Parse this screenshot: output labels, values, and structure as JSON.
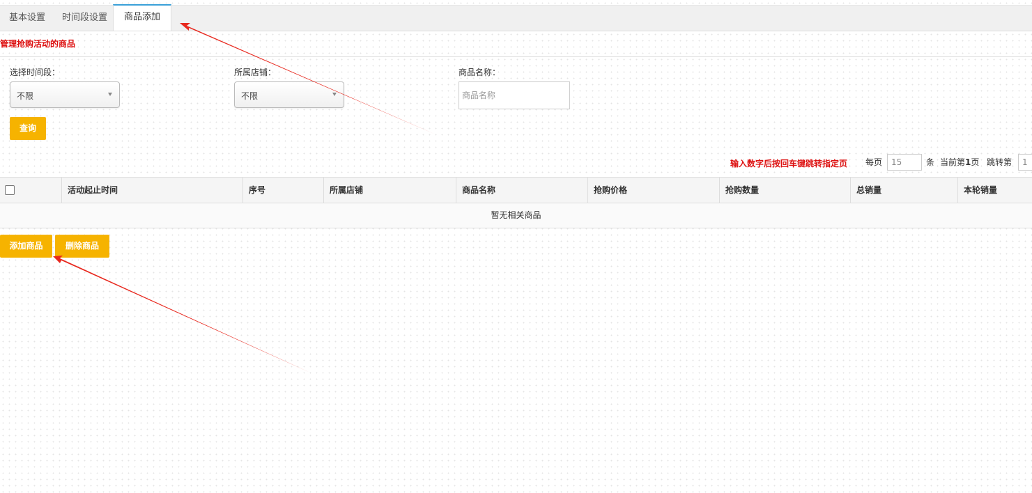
{
  "tabs": [
    {
      "label": "基本设置",
      "active": false
    },
    {
      "label": "时间段设置",
      "active": false
    },
    {
      "label": "商品添加",
      "active": true
    }
  ],
  "section_title": "管理抢购活动的商品",
  "filters": {
    "time_label": "选择时间段：",
    "time_value": "不限",
    "shop_label": "所属店铺：",
    "shop_value": "不限",
    "name_label": "商品名称：",
    "name_placeholder": "商品名称"
  },
  "query_button": "查询",
  "pager": {
    "hint": "输入数字后按回车键跳转指定页",
    "per_page_label": "每页",
    "per_page_value": "15",
    "unit": "条",
    "current_prefix": "当前第",
    "current_page": "1",
    "current_suffix": "页",
    "jump_label": "跳转第",
    "jump_value": "1"
  },
  "table": {
    "columns": [
      "活动起止时间",
      "序号",
      "所属店铺",
      "商品名称",
      "抢购价格",
      "抢购数量",
      "总销量",
      "本轮销量"
    ],
    "empty_text": "暂无相关商品"
  },
  "actions": {
    "add": "添加商品",
    "delete": "删除商品"
  },
  "colors": {
    "accent": "#f6b300",
    "alert_red": "#dd1111",
    "tab_active_border": "#3aa0d8",
    "annotation_arrow": "#e8281e"
  }
}
